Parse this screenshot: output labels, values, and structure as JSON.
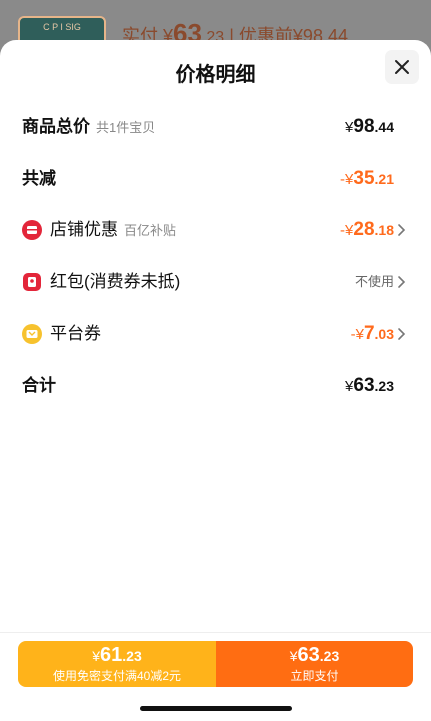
{
  "background": {
    "thumb_text": "C P I SIG",
    "pay_label": "实付",
    "pay_currency": "¥",
    "pay_int": "63",
    "pay_dec": ".23",
    "pay_sep": "|",
    "original_label": "优惠前",
    "original_amount": "¥98.44"
  },
  "sheet": {
    "title": "价格明细",
    "close_icon": "close-icon",
    "rows": [
      {
        "label": "商品总价",
        "sub": "共1件宝贝",
        "currency": "¥",
        "int": "98",
        "dec": ".44"
      },
      {
        "label": "共减",
        "currency": "-¥",
        "int": "35",
        "dec": ".21"
      },
      {
        "label": "店铺优惠",
        "sub": "百亿补贴",
        "currency": "-¥",
        "int": "28",
        "dec": ".18",
        "icon": "store-coupon-icon"
      },
      {
        "label": "红包(消费券未抵)",
        "value_text": "不使用",
        "icon": "red-packet-icon"
      },
      {
        "label": "平台券",
        "currency": "-¥",
        "int": "7",
        "dec": ".03",
        "icon": "platform-coupon-icon"
      },
      {
        "label": "合计",
        "currency": "¥",
        "int": "63",
        "dec": ".23"
      }
    ]
  },
  "actions": {
    "left": {
      "currency": "¥",
      "int": "61",
      "dec": ".23",
      "sub": "使用免密支付满40减2元"
    },
    "right": {
      "currency": "¥",
      "int": "63",
      "dec": ".23",
      "sub": "立即支付"
    }
  },
  "colors": {
    "accent_orange": "#ff6a1c",
    "left_button": "#ffb31a",
    "right_button": "#ff6d12"
  }
}
